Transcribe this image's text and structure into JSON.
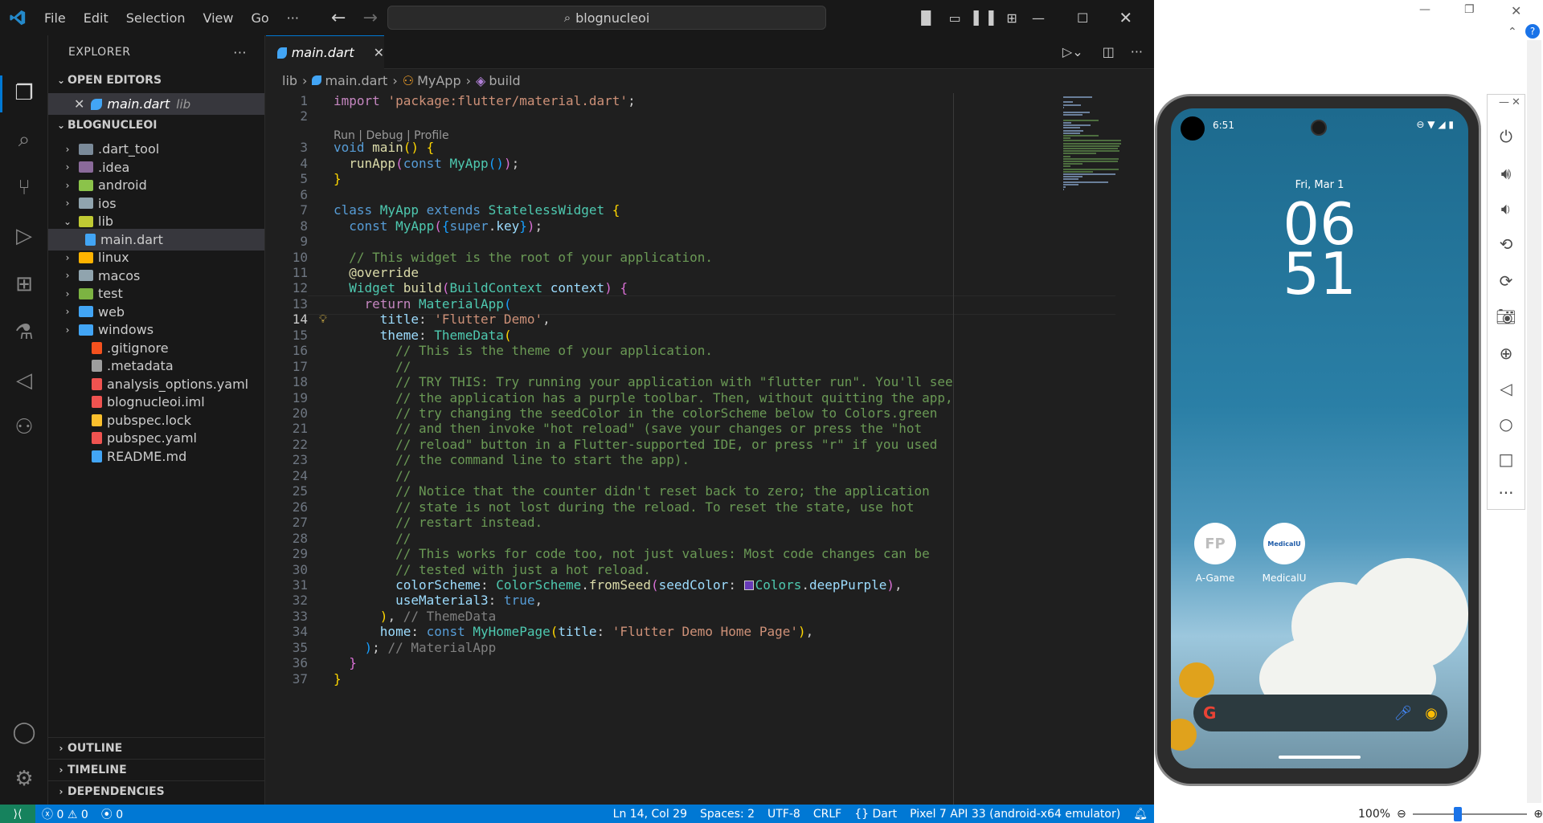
{
  "titlebar": {
    "menus": [
      "File",
      "Edit",
      "Selection",
      "View",
      "Go"
    ],
    "more": "···",
    "search": "blognucleoi"
  },
  "explorer": {
    "title": "EXPLORER",
    "open_editors_label": "OPEN EDITORS",
    "open_editor": {
      "name": "main.dart",
      "desc": "lib"
    },
    "project_label": "BLOGNUCLEOI",
    "items": [
      {
        "name": ".dart_tool",
        "type": "folder",
        "color": "#7a8a99"
      },
      {
        "name": ".idea",
        "type": "folder",
        "color": "#8a6a9a"
      },
      {
        "name": "android",
        "type": "folder",
        "color": "#8bc34a"
      },
      {
        "name": "ios",
        "type": "folder",
        "color": "#90a4ae"
      },
      {
        "name": "lib",
        "type": "folder-open",
        "color": "#c0ca33"
      },
      {
        "name": "main.dart",
        "type": "file",
        "color": "#42a5f5"
      },
      {
        "name": "linux",
        "type": "folder",
        "color": "#ffb300"
      },
      {
        "name": "macos",
        "type": "folder",
        "color": "#90a4ae"
      },
      {
        "name": "test",
        "type": "folder",
        "color": "#7cb342"
      },
      {
        "name": "web",
        "type": "folder",
        "color": "#42a5f5"
      },
      {
        "name": "windows",
        "type": "folder",
        "color": "#42a5f5"
      },
      {
        "name": ".gitignore",
        "type": "file",
        "color": "#f4511e"
      },
      {
        "name": ".metadata",
        "type": "file",
        "color": "#9e9e9e"
      },
      {
        "name": "analysis_options.yaml",
        "type": "file",
        "color": "#ef5350"
      },
      {
        "name": "blognucleoi.iml",
        "type": "file",
        "color": "#ef5350"
      },
      {
        "name": "pubspec.lock",
        "type": "file",
        "color": "#fbc02d"
      },
      {
        "name": "pubspec.yaml",
        "type": "file",
        "color": "#ef5350"
      },
      {
        "name": "README.md",
        "type": "file",
        "color": "#42a5f5"
      }
    ],
    "outline": "OUTLINE",
    "timeline": "TIMELINE",
    "dependencies": "DEPENDENCIES"
  },
  "editor": {
    "tab": "main.dart",
    "breadcrumb": [
      "lib",
      "main.dart",
      "MyApp",
      "build"
    ],
    "codelens": "Run | Debug | Profile",
    "lines": [
      {
        "n": "1",
        "t": [
          [
            "kw2",
            "import "
          ],
          [
            "str",
            "'package:flutter/material.dart'"
          ],
          [
            "",
            "; "
          ]
        ]
      },
      {
        "n": "2",
        "t": []
      },
      {
        "n": "3",
        "t": [
          [
            "kw",
            "void "
          ],
          [
            "fn",
            "main"
          ],
          [
            "b1",
            "() "
          ],
          [
            "b1",
            "{"
          ]
        ]
      },
      {
        "n": "4",
        "t": [
          [
            "",
            "  "
          ],
          [
            "fn",
            "runApp"
          ],
          [
            "b2",
            "("
          ],
          [
            "kw",
            "const "
          ],
          [
            "ty",
            "MyApp"
          ],
          [
            "b3",
            "()"
          ],
          [
            "b2",
            ")"
          ],
          [
            "",
            ";"
          ]
        ]
      },
      {
        "n": "5",
        "t": [
          [
            "b1",
            "}"
          ]
        ]
      },
      {
        "n": "6",
        "t": []
      },
      {
        "n": "7",
        "t": [
          [
            "kw",
            "class "
          ],
          [
            "ty",
            "MyApp "
          ],
          [
            "kw",
            "extends "
          ],
          [
            "ty",
            "StatelessWidget "
          ],
          [
            "b1",
            "{"
          ]
        ]
      },
      {
        "n": "8",
        "t": [
          [
            "",
            "  "
          ],
          [
            "kw",
            "const "
          ],
          [
            "ty",
            "MyApp"
          ],
          [
            "b2",
            "("
          ],
          [
            "b3",
            "{"
          ],
          [
            "kw",
            "super"
          ],
          [
            "",
            ".",
            ""
          ],
          [
            "pr",
            "key"
          ],
          [
            "b3",
            "}"
          ],
          [
            "b2",
            ")"
          ],
          [
            "",
            ";"
          ]
        ]
      },
      {
        "n": "9",
        "t": []
      },
      {
        "n": "10",
        "t": [
          [
            "cm",
            "  // This widget is the root of your application."
          ]
        ]
      },
      {
        "n": "11",
        "t": [
          [
            "",
            "  "
          ],
          [
            "fn",
            "@override"
          ]
        ]
      },
      {
        "n": "12",
        "t": [
          [
            "",
            "  "
          ],
          [
            "ty",
            "Widget "
          ],
          [
            "fn",
            "build"
          ],
          [
            "b2",
            "("
          ],
          [
            "ty",
            "BuildContext "
          ],
          [
            "pr",
            "context"
          ],
          [
            "b2",
            ") "
          ],
          [
            "b2",
            "{"
          ]
        ]
      },
      {
        "n": "13",
        "t": [
          [
            "",
            "    "
          ],
          [
            "kw2",
            "return "
          ],
          [
            "ty",
            "MaterialApp"
          ],
          [
            "b3",
            "("
          ]
        ]
      },
      {
        "n": "14",
        "t": [
          [
            "",
            "      "
          ],
          [
            "pr",
            "title"
          ],
          [
            "",
            ": "
          ],
          [
            "str",
            "'Flutter Demo'"
          ],
          [
            "",
            ","
          ]
        ]
      },
      {
        "n": "15",
        "t": [
          [
            "",
            "      "
          ],
          [
            "pr",
            "theme"
          ],
          [
            "",
            ": "
          ],
          [
            "ty",
            "ThemeData"
          ],
          [
            "b1",
            "("
          ]
        ]
      },
      {
        "n": "16",
        "t": [
          [
            "cm",
            "        // This is the theme of your application."
          ]
        ]
      },
      {
        "n": "17",
        "t": [
          [
            "cm",
            "        //"
          ]
        ]
      },
      {
        "n": "18",
        "t": [
          [
            "cm",
            "        // TRY THIS: Try running your application with \"flutter run\". You'll see"
          ]
        ]
      },
      {
        "n": "19",
        "t": [
          [
            "cm",
            "        // the application has a purple toolbar. Then, without quitting the app,"
          ]
        ]
      },
      {
        "n": "20",
        "t": [
          [
            "cm",
            "        // try changing the seedColor in the colorScheme below to Colors.green"
          ]
        ]
      },
      {
        "n": "21",
        "t": [
          [
            "cm",
            "        // and then invoke \"hot reload\" (save your changes or press the \"hot"
          ]
        ]
      },
      {
        "n": "22",
        "t": [
          [
            "cm",
            "        // reload\" button in a Flutter-supported IDE, or press \"r\" if you used"
          ]
        ]
      },
      {
        "n": "23",
        "t": [
          [
            "cm",
            "        // the command line to start the app)."
          ]
        ]
      },
      {
        "n": "24",
        "t": [
          [
            "cm",
            "        //"
          ]
        ]
      },
      {
        "n": "25",
        "t": [
          [
            "cm",
            "        // Notice that the counter didn't reset back to zero; the application"
          ]
        ]
      },
      {
        "n": "26",
        "t": [
          [
            "cm",
            "        // state is not lost during the reload. To reset the state, use hot"
          ]
        ]
      },
      {
        "n": "27",
        "t": [
          [
            "cm",
            "        // restart instead."
          ]
        ]
      },
      {
        "n": "28",
        "t": [
          [
            "cm",
            "        //"
          ]
        ]
      },
      {
        "n": "29",
        "t": [
          [
            "cm",
            "        // This works for code too, not just values: Most code changes can be"
          ]
        ]
      },
      {
        "n": "30",
        "t": [
          [
            "cm",
            "        // tested with just a hot reload."
          ]
        ]
      },
      {
        "n": "31",
        "t": [
          [
            "",
            "        "
          ],
          [
            "pr",
            "colorScheme"
          ],
          [
            "",
            ": "
          ],
          [
            "ty",
            "ColorScheme"
          ],
          [
            "",
            "."
          ],
          [
            "fn",
            "fromSeed"
          ],
          [
            "b2",
            "("
          ],
          [
            "pr",
            "seedColor"
          ],
          [
            "",
            ": "
          ],
          [
            "swatch",
            ""
          ],
          [
            "ty",
            "Colors"
          ],
          [
            "",
            "."
          ],
          [
            "pr",
            "deepPurple"
          ],
          [
            "b2",
            ")"
          ],
          [
            "",
            ","
          ]
        ]
      },
      {
        "n": "32",
        "t": [
          [
            "",
            "        "
          ],
          [
            "pr",
            "useMaterial3"
          ],
          [
            "",
            ": "
          ],
          [
            "kw",
            "true"
          ],
          [
            "",
            ","
          ]
        ]
      },
      {
        "n": "33",
        "t": [
          [
            "",
            "      "
          ],
          [
            "b1",
            ")"
          ],
          [
            "",
            ", "
          ],
          [
            "gr",
            "// ThemeData"
          ]
        ]
      },
      {
        "n": "34",
        "t": [
          [
            "",
            "      "
          ],
          [
            "pr",
            "home"
          ],
          [
            "",
            ": "
          ],
          [
            "kw",
            "const "
          ],
          [
            "ty",
            "MyHomePage"
          ],
          [
            "b1",
            "("
          ],
          [
            "pr",
            "title"
          ],
          [
            "",
            ": "
          ],
          [
            "str",
            "'Flutter Demo Home Page'"
          ],
          [
            "b1",
            ")"
          ],
          [
            "",
            ","
          ]
        ]
      },
      {
        "n": "35",
        "t": [
          [
            "",
            "    "
          ],
          [
            "b3",
            ")"
          ],
          [
            "",
            "; "
          ],
          [
            "gr",
            "// MaterialApp"
          ]
        ]
      },
      {
        "n": "36",
        "t": [
          [
            "",
            "  "
          ],
          [
            "b2",
            "}"
          ]
        ]
      },
      {
        "n": "37",
        "t": [
          [
            "b1",
            "}"
          ]
        ]
      }
    ]
  },
  "statusbar": {
    "errors": "0",
    "warnings": "0",
    "ports": "0",
    "position": "Ln 14, Col 29",
    "spaces": "Spaces: 2",
    "encoding": "UTF-8",
    "eol": "CRLF",
    "language": "Dart",
    "device": "Pixel 7 API 33 (android-x64 emulator)"
  },
  "phone": {
    "time": "6:51",
    "date": "Fri, Mar 1",
    "clock_h": "06",
    "clock_m": "51",
    "apps": [
      {
        "label": "A-Game",
        "icon": "FP"
      },
      {
        "label": "MedicalU",
        "icon": "MedicalU"
      }
    ]
  },
  "emulator": {
    "zoom": "100%"
  }
}
